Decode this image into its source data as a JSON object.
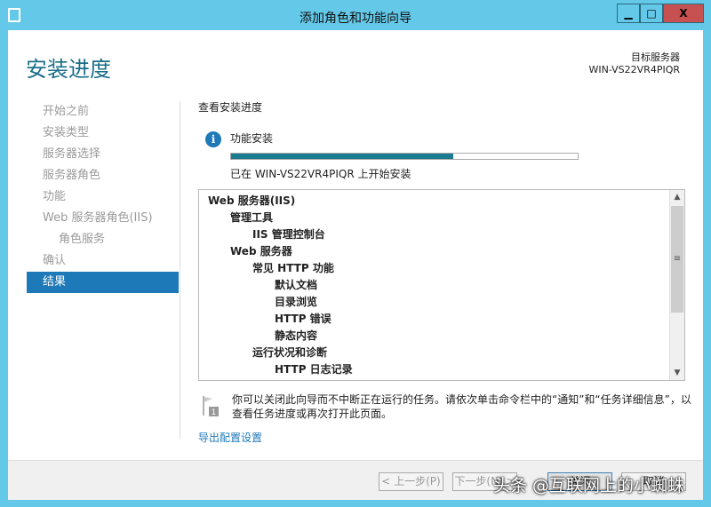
{
  "window": {
    "title": "添加角色和功能向导",
    "minimize": "▁",
    "maximize": "□",
    "close": "X"
  },
  "page": {
    "heading": "安装进度",
    "target_label": "目标服务器",
    "target_server": "WIN-VS22VR4PIQR"
  },
  "nav": [
    {
      "label": "开始之前"
    },
    {
      "label": "安装类型"
    },
    {
      "label": "服务器选择"
    },
    {
      "label": "服务器角色"
    },
    {
      "label": "功能"
    },
    {
      "label": "Web 服务器角色(IIS)"
    },
    {
      "label": "角色服务"
    },
    {
      "label": "确认"
    },
    {
      "label": "结果"
    }
  ],
  "main": {
    "section_title": "查看安装进度",
    "feature_label": "功能安装",
    "progress_percent": 64,
    "status": "已在 WIN-VS22VR4PIQR 上开始安装",
    "items": [
      {
        "label": "Web 服务器(IIS)",
        "level": 0
      },
      {
        "label": "管理工具",
        "level": 1
      },
      {
        "label": "IIS 管理控制台",
        "level": 2
      },
      {
        "label": "Web 服务器",
        "level": 1
      },
      {
        "label": "常见 HTTP 功能",
        "level": 2
      },
      {
        "label": "默认文档",
        "level": 3
      },
      {
        "label": "目录浏览",
        "level": 3
      },
      {
        "label": "HTTP 错误",
        "level": 3
      },
      {
        "label": "静态内容",
        "level": 3
      },
      {
        "label": "运行状况和诊断",
        "level": 2
      },
      {
        "label": "HTTP 日志记录",
        "level": 3
      }
    ],
    "note": "你可以关闭此向导而不中断正在运行的任务。请依次单击命令栏中的“通知”和“任务详细信息”，以查看任务进度或再次打开此页面。",
    "note_badge": "1",
    "export_link": "导出配置设置"
  },
  "footer": {
    "prev": "< 上一步(P)",
    "next": "下一步(N) >",
    "close": "关闭",
    "cancel": "取消"
  },
  "watermark": "头条 @互联网上的小蜘蛛"
}
